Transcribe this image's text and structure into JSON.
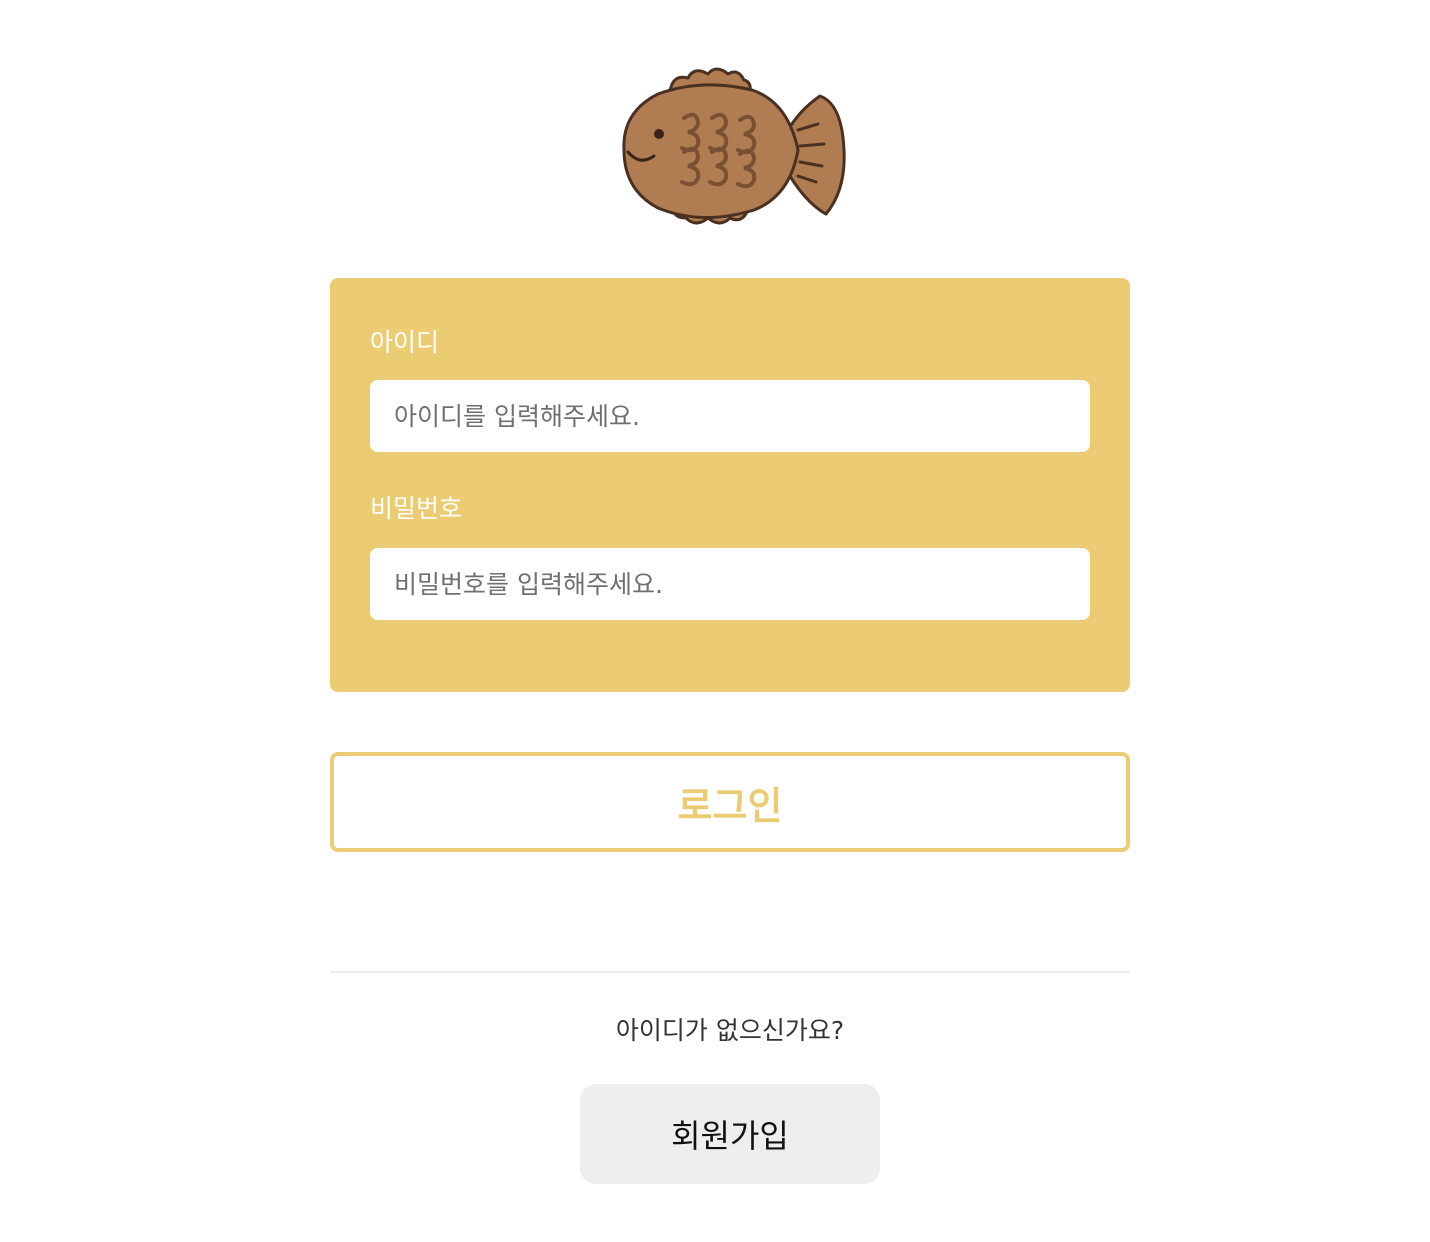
{
  "logo": {
    "icon": "bungeoppang-fish-icon",
    "colors": {
      "body": "#b07d52",
      "outline": "#4a3020",
      "pattern": "#7a5032"
    }
  },
  "colors": {
    "accent": "#eccc72",
    "panel_text": "#ffffff",
    "signup_bg": "#eeeeee"
  },
  "login_form": {
    "id_label": "아이디",
    "id_placeholder": "아이디를 입력해주세요.",
    "id_value": "",
    "password_label": "비밀번호",
    "password_placeholder": "비밀번호를 입력해주세요.",
    "password_value": ""
  },
  "login_button_label": "로그인",
  "signup": {
    "prompt": "아이디가 없으신가요?",
    "button_label": "회원가입"
  }
}
